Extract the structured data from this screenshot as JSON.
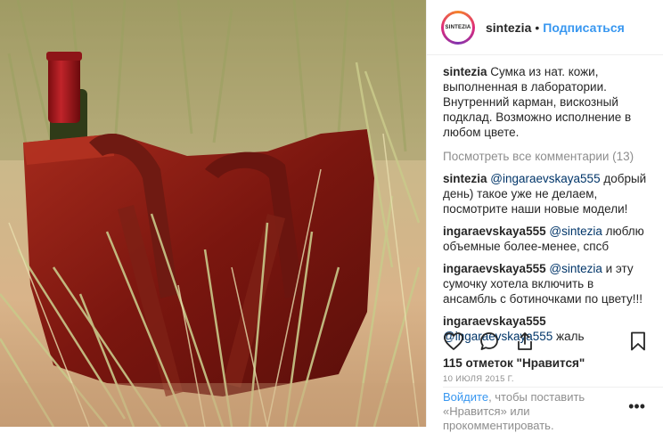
{
  "post": {
    "username": "sintezia",
    "avatar_text": "SINTEZIA",
    "header_dot": "•",
    "follow_label": "Подписаться",
    "caption": {
      "user": "sintezia",
      "text": "Сумка из нат. кожи, выполненная в лаборатории. Внутренний карман, вискозный подклад. Возможно исполнение в любом цвете."
    },
    "view_all_label": "Посмотреть все комментарии (13)",
    "comments": [
      {
        "user": "sintezia",
        "mention": "@ingaraevskaya555",
        "text": "добрый день) такое уже не делаем, посмотрите наши новые модели!"
      },
      {
        "user": "ingaraevskaya555",
        "mention": "@sintezia",
        "text": "люблю объемные более-менее, спсб"
      },
      {
        "user": "ingaraevskaya555",
        "mention": "@sintezia",
        "text": "и эту сумочку хотела включить в ансамбль с ботиночками по цвету!!!"
      },
      {
        "user": "ingaraevskaya555",
        "mention": "@ingaraevskaya555",
        "text": "жаль"
      }
    ],
    "likes_label": "115 отметок \"Нравится\"",
    "date_label": "10 ИЮЛЯ 2015 Г.",
    "login_link": "Войдите",
    "login_text": ", чтобы поставить «Нравится» или прокомментировать.",
    "more_label": "•••"
  },
  "icons": {
    "like": "heart-icon",
    "comment": "comment-icon",
    "share": "share-icon",
    "save": "bookmark-icon"
  },
  "colors": {
    "accent": "#3897f0",
    "mention": "#003569",
    "muted": "#8e8e8e",
    "bag": "#8a1e14"
  }
}
